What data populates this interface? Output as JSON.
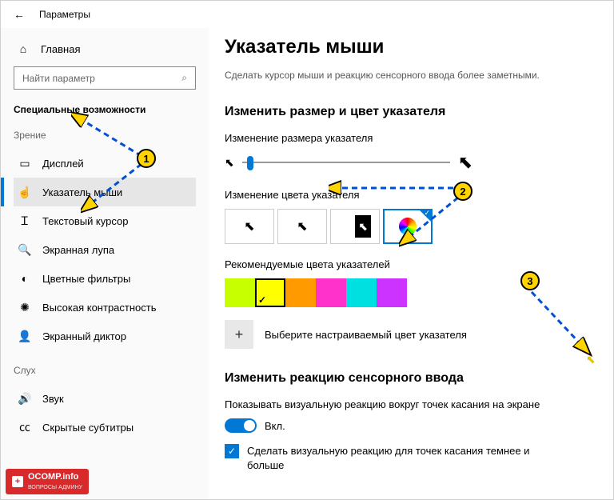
{
  "window": {
    "title": "Параметры"
  },
  "sidebar": {
    "home": "Главная",
    "search_placeholder": "Найти параметр",
    "section": "Специальные возможности",
    "group_vision": "Зрение",
    "group_hearing": "Слух",
    "items_vision": [
      {
        "icon": "display-icon",
        "label": "Дисплей"
      },
      {
        "icon": "pointer-icon",
        "label": "Указатель мыши",
        "active": true
      },
      {
        "icon": "text-cursor-icon",
        "label": "Текстовый курсор"
      },
      {
        "icon": "magnifier-icon",
        "label": "Экранная лупа"
      },
      {
        "icon": "color-filter-icon",
        "label": "Цветные фильтры"
      },
      {
        "icon": "contrast-icon",
        "label": "Высокая контрастность"
      },
      {
        "icon": "narrator-icon",
        "label": "Экранный диктор"
      }
    ],
    "items_hearing": [
      {
        "icon": "sound-icon",
        "label": "Звук"
      },
      {
        "icon": "captions-icon",
        "label": "Скрытые субтитры"
      }
    ]
  },
  "main": {
    "title": "Указатель мыши",
    "subtitle": "Сделать курсор мыши и реакцию сенсорного ввода более заметными.",
    "section_size_color": "Изменить размер и цвет указателя",
    "size_label": "Изменение размера указателя",
    "color_label": "Изменение цвета указателя",
    "recommended_label": "Рекомендуемые цвета указателей",
    "custom_color_label": "Выберите настраиваемый цвет указателя",
    "section_touch": "Изменить реакцию сенсорного ввода",
    "touch_desc": "Показывать визуальную реакцию вокруг точек касания на экране",
    "toggle_on": "Вкл.",
    "touch_darker": "Сделать визуальную реакцию для точек касания темнее и больше",
    "swatches": [
      "#c8ff00",
      "#ffff00",
      "#ff9a00",
      "#ff33cc",
      "#00e0e0",
      "#cc33ff"
    ],
    "selected_swatch_index": 1
  },
  "annotations": {
    "b1": "1",
    "b2": "2",
    "b3": "3"
  },
  "watermark": {
    "brand": "OCOMP.info",
    "tag": "ВОПРОСЫ АДМИНУ"
  }
}
